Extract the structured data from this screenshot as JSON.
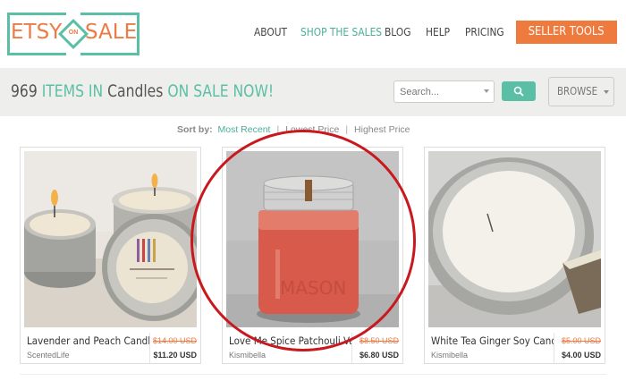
{
  "logo": {
    "left_word": "ETSY",
    "middle_word": "ON",
    "right_word": "SALE"
  },
  "nav": {
    "about": "ABOUT",
    "shop_the_sales": "SHOP THE SALES",
    "blog": "BLOG",
    "help": "HELP",
    "pricing": "PRICING"
  },
  "seller_tools": "SELLER TOOLS",
  "headline": {
    "count": "969",
    "items_in": "ITEMS IN",
    "category": "Candles",
    "on_sale_now": "ON SALE NOW!"
  },
  "search": {
    "placeholder": "Search...",
    "button_icon": "search-icon"
  },
  "browse": "BROWSE",
  "sort": {
    "label": "Sort by:",
    "options": [
      "Most Recent",
      "Lowest Price",
      "Highest Price"
    ],
    "active": "Most Recent"
  },
  "products": [
    {
      "title": "Lavender and Peach Candle",
      "shop": "ScentedLife",
      "old_price": "$14.00 USD",
      "new_price": "$11.20 USD"
    },
    {
      "title": "Love Me Spice Patchouli Van",
      "shop": "Kismibella",
      "old_price": "$8.50 USD",
      "new_price": "$6.80 USD"
    },
    {
      "title": "White Tea Ginger Soy Candle",
      "shop": "Kismibella",
      "old_price": "$5.00 USD",
      "new_price": "$4.00 USD"
    }
  ],
  "product_images": [
    "lavender-tin-candles-photo",
    "mason-jar-red-candle-photo",
    "white-tin-candle-photo"
  ],
  "colors": {
    "teal": "#5bbfa6",
    "orange": "#ec7b45",
    "highlight_circle": "#c8191e"
  }
}
